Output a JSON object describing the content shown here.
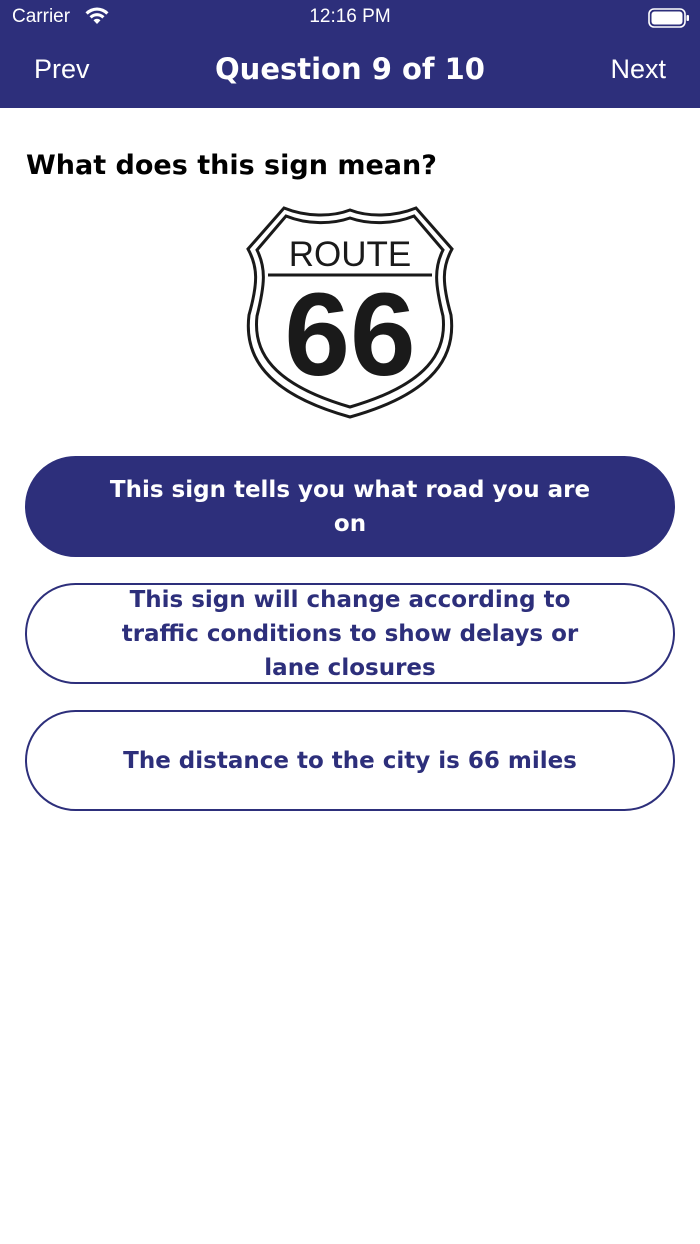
{
  "status_bar": {
    "carrier": "Carrier",
    "time": "12:16 PM",
    "icons": [
      "wifi-icon",
      "battery-icon"
    ]
  },
  "nav": {
    "prev_label": "Prev",
    "title": "Question 9 of 10",
    "next_label": "Next"
  },
  "question": {
    "text": "What does this sign mean?",
    "sign": {
      "top_text": "ROUTE",
      "number": "66"
    }
  },
  "answers": [
    {
      "text": "This sign tells you what road you are on",
      "selected": true
    },
    {
      "text": "This sign will change according to traffic conditions to show delays or lane closures",
      "selected": false
    },
    {
      "text": "The distance to the city is 66 miles",
      "selected": false
    }
  ],
  "colors": {
    "primary": "#2d2f7b",
    "background": "#ffffff",
    "text": "#000000"
  }
}
